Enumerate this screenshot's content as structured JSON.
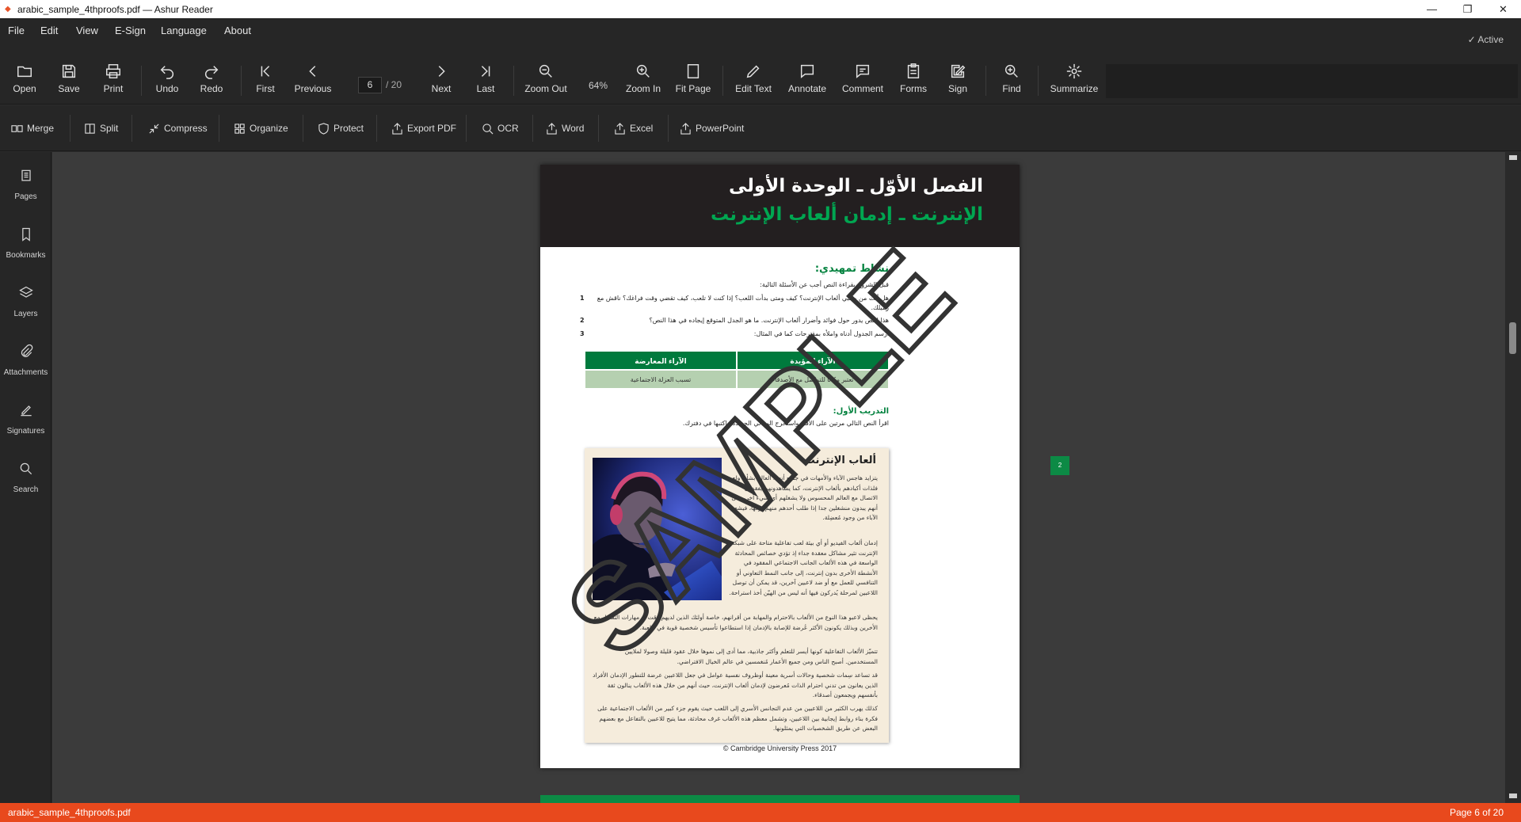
{
  "window": {
    "title": "arabic_sample_4thproofs.pdf — Ashur Reader",
    "minimize": "—",
    "restore": "❐",
    "close": "✕"
  },
  "menu": {
    "items": [
      "File",
      "Edit",
      "View",
      "E-Sign",
      "Language",
      "About"
    ],
    "status": "✓  Active"
  },
  "toolbar": {
    "open": "Open",
    "save": "Save",
    "print": "Print",
    "undo": "Undo",
    "redo": "Redo",
    "first": "First",
    "previous": "Previous",
    "page_value": "6",
    "page_total": "/ 20",
    "next": "Next",
    "last": "Last",
    "zoom_out": "Zoom Out",
    "zoom_level": "64%",
    "zoom_in": "Zoom In",
    "fit_page": "Fit Page",
    "edit_text": "Edit Text",
    "annotate": "Annotate",
    "comment": "Comment",
    "forms": "Forms",
    "sign": "Sign",
    "find": "Find",
    "summarize": "Summarize"
  },
  "convert": {
    "merge": "Merge",
    "split": "Split",
    "compress": "Compress",
    "organize": "Organize",
    "protect": "Protect",
    "export_pdf": "Export PDF",
    "ocr": "OCR",
    "word": "Word",
    "excel": "Excel",
    "powerpoint": "PowerPoint"
  },
  "sidebar": {
    "pages": "Pages",
    "bookmarks": "Bookmarks",
    "layers": "Layers",
    "attachments": "Attachments",
    "signatures": "Signatures",
    "search": "Search"
  },
  "document": {
    "header_title": "الفصل الأوّل ـ الوحدة الأولى",
    "header_subtitle": "الإنترنت ـ إدمان ألعاب الإنترنت",
    "section_title": "نشاط تمهيدي:",
    "intro": "قبل الشروع بقراءة النص أجب عن الأسئلة التالية:",
    "questions": [
      {
        "n": "1",
        "text": "هل أنت من محبي ألعاب الإنترنت؟ كيف ومتى بدأت اللعب؟ إذا كنت لا تلعب، كيف تقضي وقت فراغك؟ ناقش مع زميلك."
      },
      {
        "n": "2",
        "text": "هذا النص يدور حول فوائد وأضرار ألعاب الإنترنت. ما هو الجدل المتوقع إيجاده في هذا النص؟"
      },
      {
        "n": "3",
        "text": "ارسم الجدول أدناه واملأه بمقترحات كما في المثال:"
      }
    ],
    "table_headers": [
      "الآراء المؤيدة",
      "الآراء المعارضة"
    ],
    "table_row": [
      "تعتبر مكاناً للتواصل مع الأصدقاء",
      "تسبب العزلة الاجتماعية"
    ],
    "drill_title": "التدريب الأول:",
    "drill_text": "اقرأ النص التالي مرتين على الأقل واستخرج المعاني الجديدة واكتبها في دفترك.",
    "article_title": "ألعاب الإنترنت",
    "article_paragraphs": [
      "يتزايد هاجس الآباء والأمهات في جميع أنحاء العالم بشأن ولع فلذات أكبادهم بألعاب الإنترنت، كما يشاهدونهم يفقدون الاتصال مع العالم المحسوس ولا يشغلهم أي شيء آخر، حتى أنهم يبدون منشغلين جدا إذا طلب أحدهم منهم تركها، فيشعر الآباء من وجود مُعضِلة.",
      "إدمان ألعاب الفيديو أو أي بيئة لعب تفاعلية متاحة على شبكة الإنترنت تثير مشاكل معقدة جداء إذ تؤدي خصائص المحادثة الواسعة في هذه الألعاب الجانب الاجتماعي المفقود في الأنشطة الأخرى بدون إنترنت، إلى جانب النمط التعاوني أو التنافسي للعمل مع أو ضد لاعبين آخرين، قد يمكن أن توصل اللاعبين لمرحلة يُدركون فيها أنه ليس من الهيّن أخذ استراحة.",
      "يحظى لاعبو هذا النوع من الألعاب بالاحترام والمهابة من أقرانهم، خاصة أولئك الذين لديهم وقت أو مهارات التعامل مع الأخرين وبذلك يكونون الأكثر عُرضة للإصابة بالإدمان إذا استطاعوا تأسيس شخصية قوية في اللعبة.",
      "تتميّز الألعاب التفاعلية كونها أيسر للتعلم وأكثر جاذبية، مما أدى إلى نموها خلال عقود قليلة وصولا لملايين المستخدمين. أصبح الناس ومن جميع الأعمار مُنغمسين في عالم الخيال الافتراضي.",
      "قد تساعد سِمات شخصية وحالات أسرية معينة أوظروف نفسية عوامل في جعل اللاعبين عرضة للتطور الإدمان الأفراد الذين يعانون من تدني احترام الذات مُعرضون لإدمان ألعاب الإنترنت، حيث أنهم من خلال هذه الألعاب ينالون ثقة بأنفسهم ويجمعون أصدقاء.",
      "كذلك يهرب الكثير من اللاعبين من عدم التجانس الأسري إلى اللعب حيث يقوم جزء كبير من الألعاب الاجتماعية على فكرة بناء روابط إيجابية بين اللاعبين، وتشمل معظم هذه الألعاب غرف محادثة، مما يتيح للاعبين بالتفاعل مع بعضهم البعض عن طريق الشخصيات التي يمثلونها."
    ],
    "copyright": "© Cambridge University Press 2017",
    "page_number": "2",
    "watermark": "SAMPLE"
  },
  "status": {
    "filename": "arabic_sample_4thproofs.pdf",
    "page_info": "Page 6 of 20"
  }
}
